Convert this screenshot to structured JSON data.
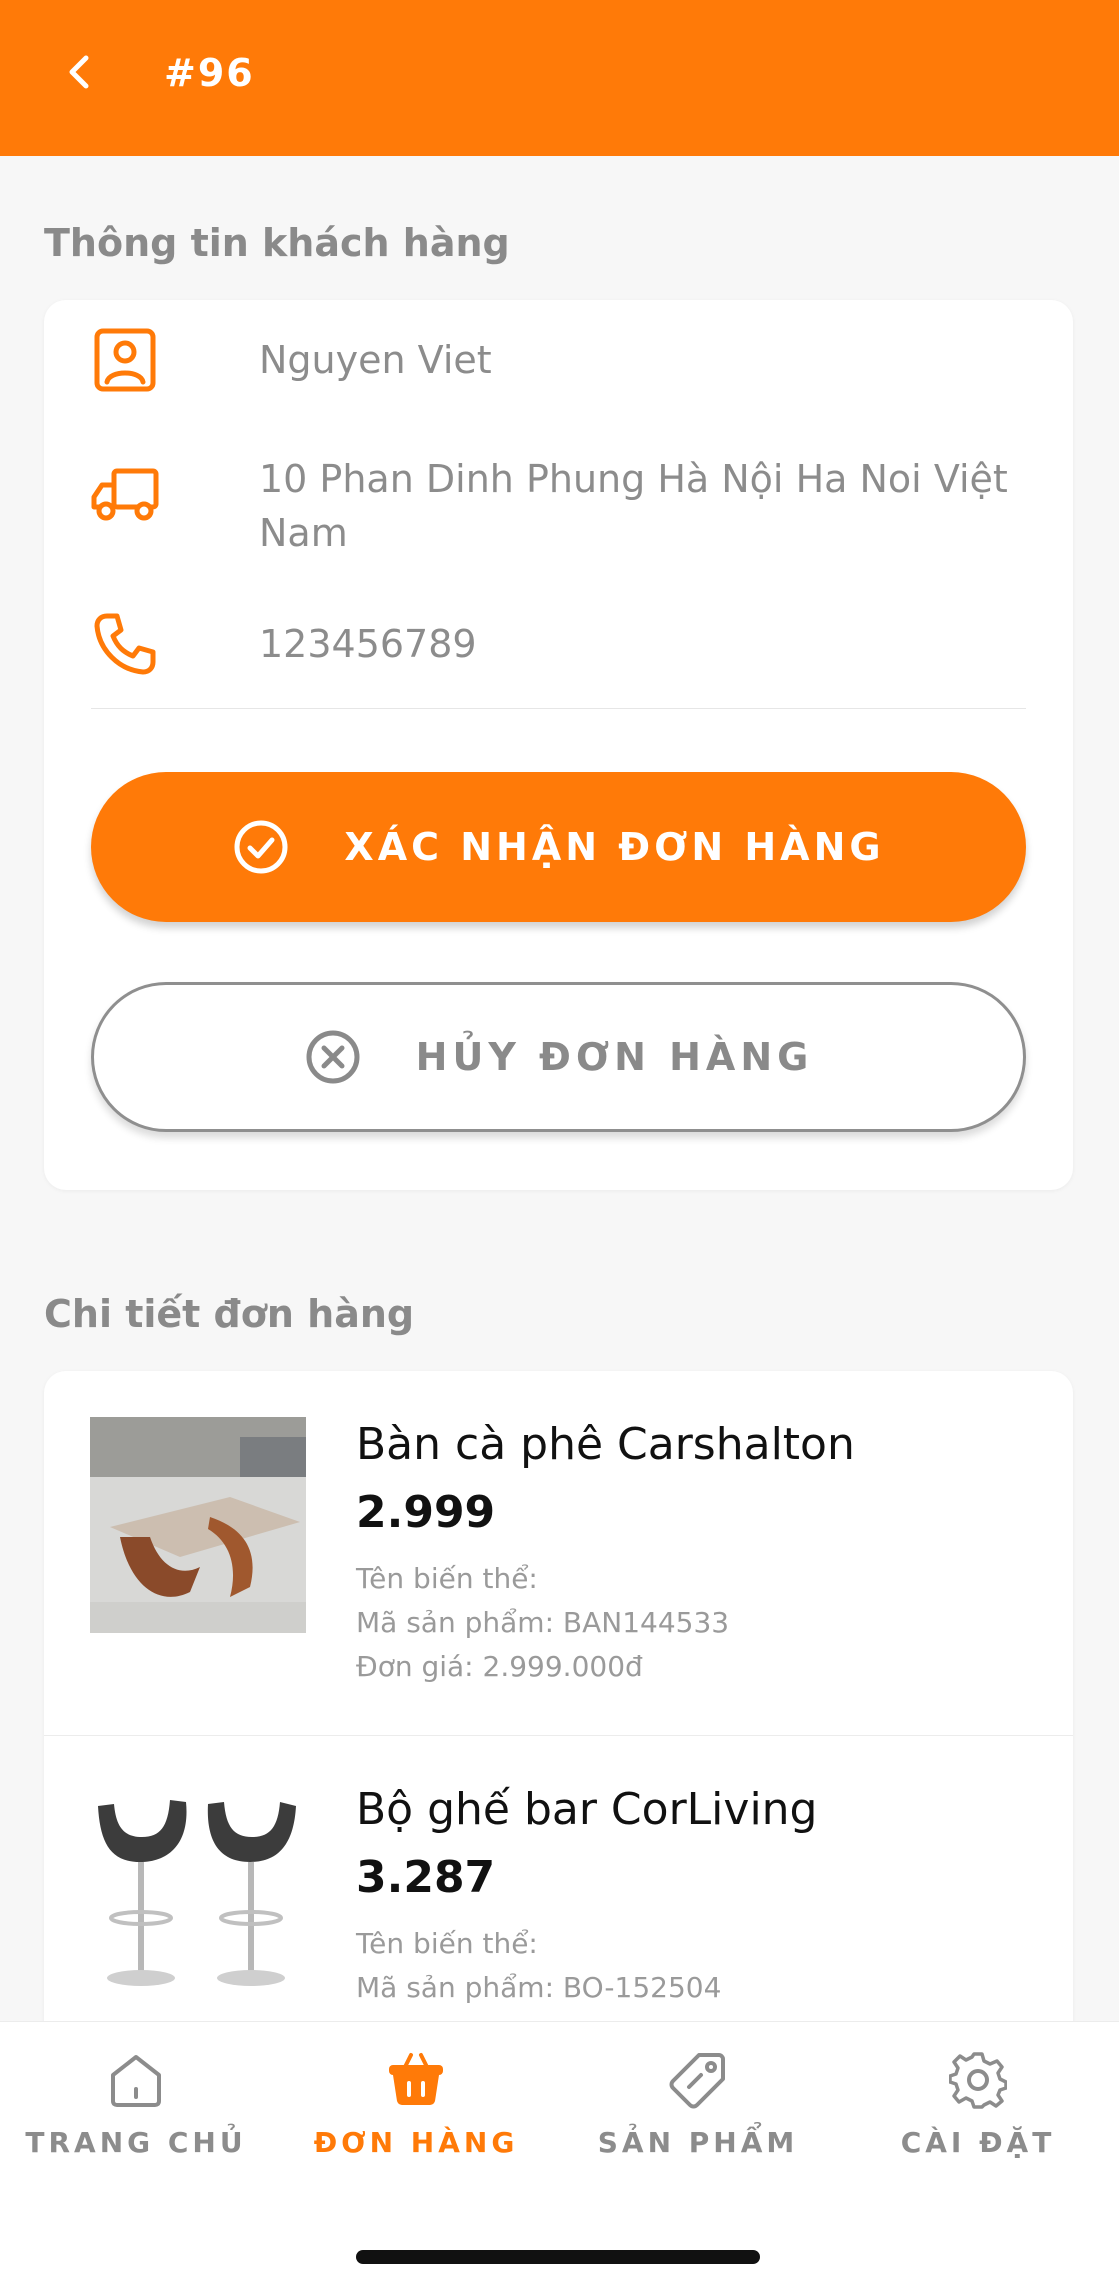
{
  "header": {
    "title": "#96",
    "back_icon": "chevron-left-icon"
  },
  "customer_section": {
    "title": "Thông tin khách hàng",
    "name": "Nguyen Viet",
    "address": "10 Phan Dinh Phung Hà Nội Ha Noi Việt Nam",
    "phone": "123456789"
  },
  "actions": {
    "confirm_label": "XÁC NHẬN ĐƠN HÀNG",
    "cancel_label": "HỦY ĐƠN HÀNG"
  },
  "detail_section": {
    "title": "Chi tiết đơn hàng",
    "products": [
      {
        "name": "Bàn cà phê Carshalton",
        "quantity": "2.999",
        "variant": "Tên biến thể:",
        "sku": "Mã sản phẩm: BAN144533",
        "price": "Đơn giá: 2.999.000đ"
      },
      {
        "name": "Bộ ghế bar CorLiving",
        "quantity": "3.287",
        "variant": "Tên biến thể:",
        "sku": "Mã sản phẩm: BO-152504"
      }
    ]
  },
  "bottom_nav": {
    "items": [
      {
        "label": "TRANG CHỦ",
        "icon": "home-icon",
        "active": false
      },
      {
        "label": "ĐƠN HÀNG",
        "icon": "basket-icon",
        "active": true
      },
      {
        "label": "SẢN PHẨM",
        "icon": "tag-icon",
        "active": false
      },
      {
        "label": "CÀI ĐẶT",
        "icon": "gear-icon",
        "active": false
      }
    ]
  },
  "colors": {
    "accent": "#ff7a08",
    "muted_text": "#8c8c8c"
  }
}
